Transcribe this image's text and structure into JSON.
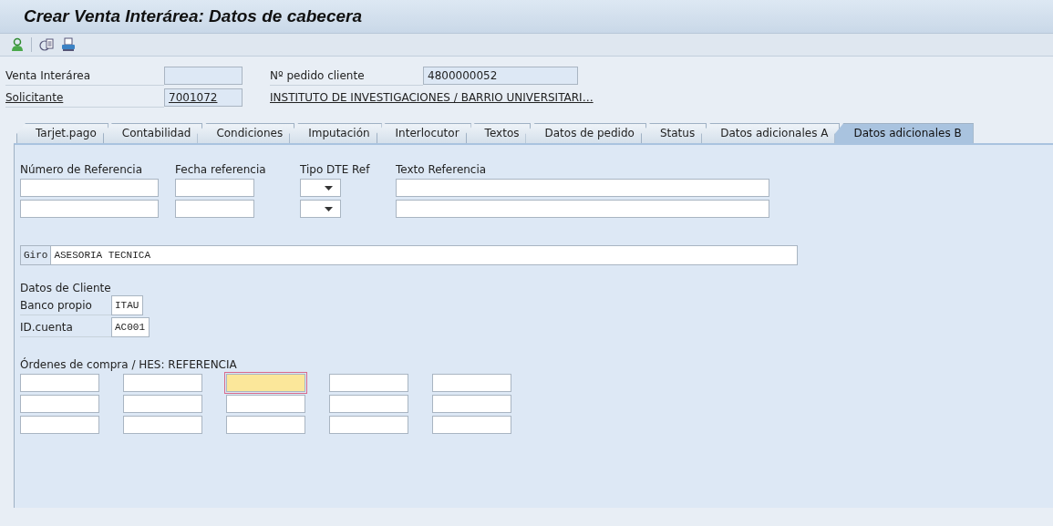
{
  "window": {
    "title": "Crear Venta Interárea: Datos de cabecera"
  },
  "header": {
    "venta_interarea": {
      "label": "Venta Interárea"
    },
    "pedido_cliente": {
      "label": "Nº pedido cliente",
      "value": "4800000052"
    },
    "solicitante": {
      "label": "Solicitante",
      "value": "7001072",
      "description": "INSTITUTO DE INVESTIGACIONES / BARRIO UNIVERSITARI…"
    }
  },
  "tabs": [
    {
      "label": "Tarjet.pago",
      "selected": false
    },
    {
      "label": "Contabilidad",
      "selected": false
    },
    {
      "label": "Condiciones",
      "selected": false
    },
    {
      "label": "Imputación",
      "selected": false
    },
    {
      "label": "Interlocutor",
      "selected": false
    },
    {
      "label": "Textos",
      "selected": false
    },
    {
      "label": "Datos de pedido",
      "selected": false
    },
    {
      "label": "Status",
      "selected": false
    },
    {
      "label": "Datos adicionales A",
      "selected": false
    },
    {
      "label": "Datos adicionales B",
      "selected": true
    }
  ],
  "reference": {
    "columns": [
      "Número de Referencia",
      "Fecha referencia",
      "Tipo DTE Ref",
      "Texto Referencia"
    ],
    "rows": [
      [
        {
          "kind": "text"
        },
        {
          "kind": "text"
        },
        {
          "kind": "dropdown"
        },
        {
          "kind": "text"
        }
      ],
      [
        {
          "kind": "text"
        },
        {
          "kind": "text"
        },
        {
          "kind": "dropdown"
        },
        {
          "kind": "text"
        }
      ]
    ]
  },
  "giro": {
    "label": "Giro",
    "value": "ASESORIA TECNICA"
  },
  "cliente": {
    "title": "Datos de Cliente",
    "fields": [
      {
        "label": "Banco propio",
        "value": "ITAU"
      },
      {
        "label": "ID.cuenta",
        "value": "AC001"
      }
    ]
  },
  "ordenes": {
    "title": "Órdenes de compra / HES: REFERENCIA",
    "rows": [
      [
        {
          "selected": false
        },
        {
          "selected": false
        },
        {
          "selected": true
        },
        {
          "selected": false
        },
        {
          "selected": false
        }
      ],
      [
        {
          "selected": false
        },
        {
          "selected": false
        },
        {
          "selected": false
        },
        {
          "selected": false
        },
        {
          "selected": false
        }
      ],
      [
        {
          "selected": false
        },
        {
          "selected": false
        },
        {
          "selected": false
        },
        {
          "selected": false
        },
        {
          "selected": false
        }
      ]
    ]
  }
}
